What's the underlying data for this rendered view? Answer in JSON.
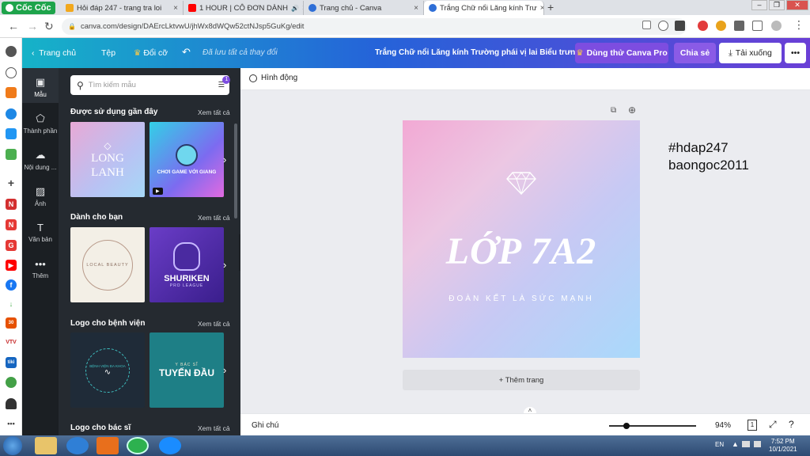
{
  "browser": {
    "brand": "Cốc Cốc",
    "tabs": [
      {
        "title": "Hỏi đáp 247 - trang tra loi",
        "favicon_color": "#f2a81d"
      },
      {
        "title": "1 HOUR | CÔ ĐƠN DÀNH",
        "favicon_color": "#ff0000"
      },
      {
        "title": "Trang chủ - Canva",
        "favicon_color": "#2f6fd7"
      },
      {
        "title": "Trắng Chữ nổi Lăng kính Trư",
        "favicon_color": "#2f6fd7"
      }
    ],
    "new_tab": "+",
    "close": "×",
    "url": "canva.com/design/DAErcLktvwU/jhWx8dWQw52ctNJsp5GuKg/edit"
  },
  "canva": {
    "header": {
      "home": "Trang chủ",
      "file": "Tệp",
      "resize": "Đổi cỡ",
      "saved_status": "Đã lưu tất cả thay đổi",
      "doc_title": "Trắng Chữ nổi Lăng kính Trường phái vị lai Biểu trưng",
      "try_pro": "Dùng thử Canva Pro",
      "share": "Chia sẻ",
      "download": "Tải xuống",
      "more": "•••"
    },
    "nav": [
      {
        "label": "Mẫu",
        "icon": "template-icon"
      },
      {
        "label": "Thành phần",
        "icon": "elements-icon"
      },
      {
        "label": "Nội dung ...",
        "icon": "upload-icon"
      },
      {
        "label": "Ảnh",
        "icon": "photo-icon"
      },
      {
        "label": "Văn bản",
        "icon": "text-icon"
      },
      {
        "label": "Thêm",
        "icon": "more-icon"
      }
    ],
    "panel": {
      "search_placeholder": "Tìm kiếm mẫu",
      "filter_badge": "1",
      "see_all": "Xem tất cả",
      "sections": [
        {
          "title": "Được sử dụng gần đây",
          "thumbs": [
            {
              "title": "LONG LANH"
            },
            {
              "title": "CHƠI GAME VỚI GIANG"
            }
          ]
        },
        {
          "title": "Dành cho bạn",
          "thumbs": [
            {
              "title": "LOCAL BEAUTY"
            },
            {
              "title": "SHURIKEN",
              "sub": "PRO LEAGUE"
            }
          ]
        },
        {
          "title": "Logo cho bệnh viện",
          "thumbs": [
            {
              "title": "BỆNH VIỆN ĐA KHOA"
            },
            {
              "title": "TUYẾN ĐẦU",
              "sub": "Y BÁC SĨ"
            }
          ]
        },
        {
          "title": "Logo cho bác sĩ"
        }
      ]
    },
    "toolbar": {
      "animate": "Hình động"
    },
    "design": {
      "title": "LỚP 7A2",
      "subtitle": "ĐOÀN KẾT LÀ SỨC MẠNH"
    },
    "add_page": "+ Thêm trang",
    "notes": "Ghi chú",
    "zoom": "94%",
    "zoom_fraction": 0.2,
    "page_count": "1",
    "hash_note": [
      "#hdap247",
      "baongoc2011"
    ]
  },
  "taskbar": {
    "lang": "EN",
    "time": "7:52 PM",
    "date": "10/1/2021"
  }
}
